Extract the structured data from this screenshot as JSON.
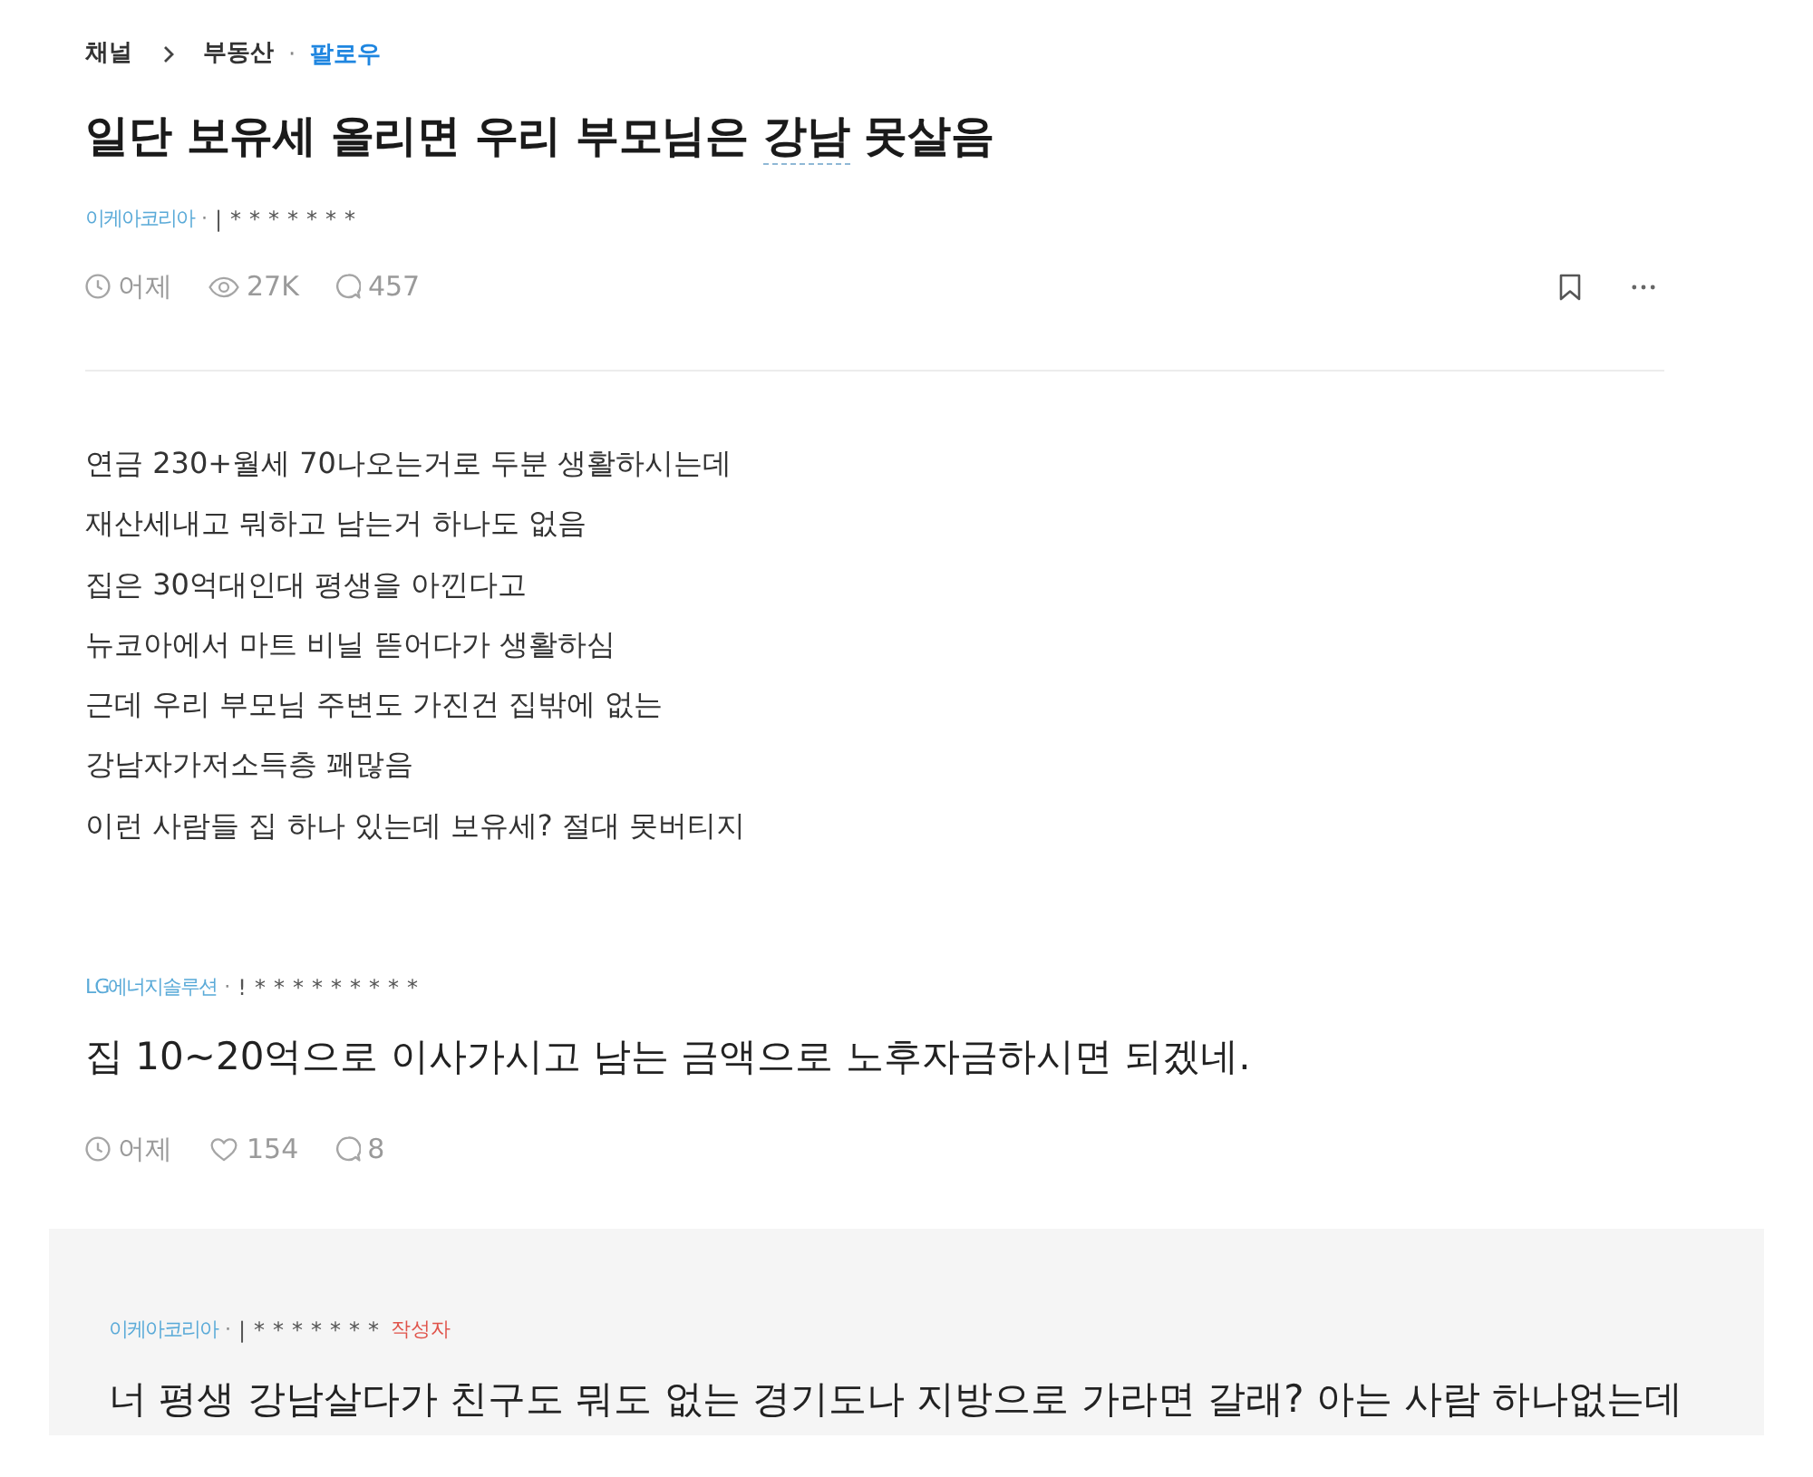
{
  "breadcrumb": {
    "channel": "채널",
    "board": "부동산",
    "separator": "·",
    "follow": "팔로우"
  },
  "post": {
    "title": {
      "before": "일단 보유세 올리면 우리 부모님은 ",
      "keyword": "강남",
      "after": " 못살음"
    },
    "author": {
      "company": "이케아코리아",
      "separator": "·",
      "user": "|*******"
    },
    "meta": [
      {
        "kind": "time",
        "text": "어제"
      },
      {
        "kind": "views",
        "text": "27K"
      },
      {
        "kind": "comments",
        "text": "457"
      }
    ],
    "bookmarked": false,
    "body": [
      "연금 230+월세 70나오는거로 두분 생활하시는데",
      "재산세내고 뭐하고 남는거 하나도 없음",
      "집은 30억대인대 평생을 아낀다고",
      "뉴코아에서 마트 비닐 뜯어다가 생활하심",
      "근데 우리 부모님 주변도 가진건 집밖에 없는",
      "강남자가저소득층 꽤많음",
      "이런 사람들 집 하나 있는데 보유세? 절대 못버티지"
    ]
  },
  "comments": [
    {
      "reply": false,
      "author": {
        "company": "LG에너지솔루션",
        "separator": "·",
        "user": "!*********"
      },
      "text": "집 10~20억으로 이사가시고 남는 금액으로 노후자금하시면 되겠네.",
      "meta": [
        {
          "kind": "time",
          "text": "어제"
        },
        {
          "kind": "likes",
          "text": "154"
        },
        {
          "kind": "replies",
          "text": "8"
        }
      ]
    },
    {
      "reply": true,
      "author": {
        "company": "이케아코리아",
        "separator": "·",
        "user": "|*******",
        "badge": "작성자"
      },
      "text": "너 평생 강남살다가 친구도 뭐도 없는 경기도나 지방으로 가라면 갈래? 아는 사람 하나없는데"
    }
  ]
}
